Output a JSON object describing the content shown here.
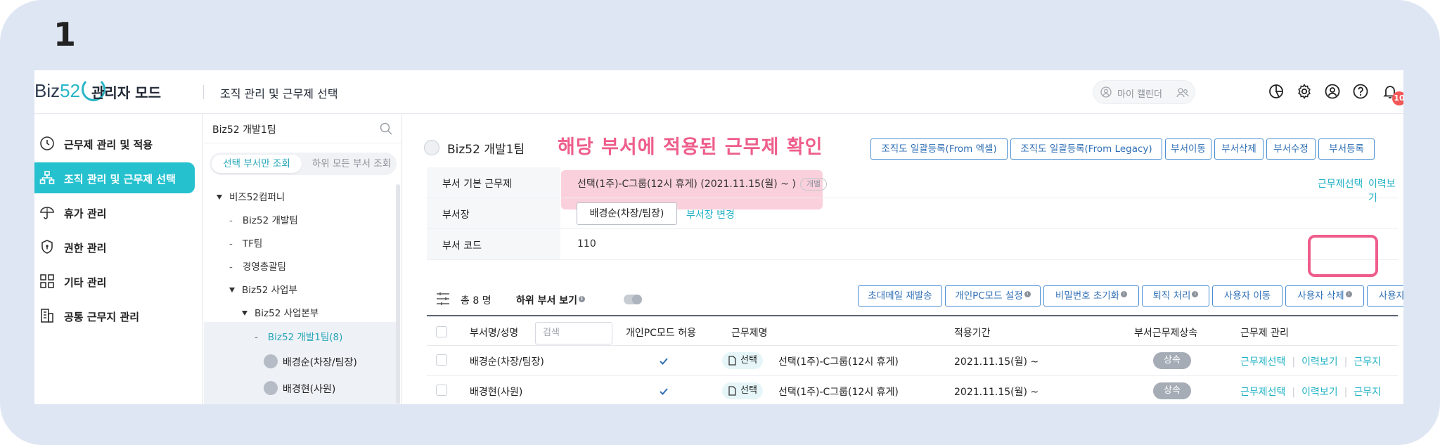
{
  "step_number": "1",
  "header": {
    "logo_text": "Biz",
    "logo_num": "52",
    "app_title": "관리자 모드",
    "page_title": "조직 관리 및 근무제 선택",
    "my_calendar": "마이 캘린더",
    "notification_count": "10"
  },
  "nav": {
    "items": [
      {
        "label": "근무제 관리 및 적용",
        "icon": "clock-icon"
      },
      {
        "label": "조직 관리 및 근무제 선택",
        "icon": "org-chart-icon"
      },
      {
        "label": "휴가 관리",
        "icon": "umbrella-icon"
      },
      {
        "label": "권한 관리",
        "icon": "shield-icon"
      },
      {
        "label": "기타 관리",
        "icon": "grid-icon"
      },
      {
        "label": "공통 근무지 관리",
        "icon": "building-icon"
      }
    ]
  },
  "tree": {
    "search_value": "Biz52 개발1팀",
    "seg_on": "선택 부서만 조회",
    "seg_off": "하위 모든 부서 조회",
    "nodes": [
      {
        "label": "비즈52컴퍼니"
      },
      {
        "label": "Biz52 개발팀"
      },
      {
        "label": "TF팀"
      },
      {
        "label": "경영총괄팀"
      },
      {
        "label": "Biz52 사업부"
      },
      {
        "label": "Biz52 사업본부"
      },
      {
        "label": "Biz52 개발1팀(8)"
      }
    ],
    "people": [
      "배경순(차장/팀장)",
      "배경현(사원)"
    ]
  },
  "main": {
    "team_title": "Biz52 개발1팀",
    "annotation": "해당 부서에 적용된 근무제 확인",
    "top_buttons": [
      "조직도 일괄등록(From 엑셀)",
      "조직도 일괄등록(From Legacy)",
      "부서이동",
      "부서삭제",
      "부서수정",
      "부서등록"
    ],
    "info": {
      "row1_key": "부서 기본 근무제",
      "row1_value": "선택(1주)-C그룹(12시 휴게) (2021.11.15(월) ~ )",
      "row1_pill": "개별",
      "row1_link1": "근무제선택",
      "row1_link2": "이력보기",
      "row2_key": "부서장",
      "row2_manager": "배경순(차장/팀장)",
      "row2_link": "부서장 변경",
      "row3_key": "부서 코드",
      "row3_value": "110"
    },
    "toolbar": {
      "count": "총 8 명",
      "sub_view": "하위 부서 보기",
      "buttons": [
        "초대메일 재발송",
        "개인PC모드 설정",
        "비밀번호 초기화",
        "퇴직 처리",
        "사용자 이동",
        "사용자 삭제",
        "사용자 등록"
      ]
    },
    "grid": {
      "headers": [
        "부서명/성명",
        "개인PC모드 허용",
        "근무제명",
        "적용기간",
        "부서근무제상속",
        "근무제 관리"
      ],
      "search_placeholder": "검색",
      "rows": [
        {
          "name": "배경순(차장/팀장)",
          "tag": "선택",
          "work": "선택(1주)-C그룹(12시 휴게)",
          "period": "2021.11.15(월) ~",
          "inherit": "상속",
          "a1": "근무제선택",
          "a2": "이력보기",
          "a3": "근무지"
        },
        {
          "name": "배경현(사원)",
          "tag": "선택",
          "work": "선택(1주)-C그룹(12시 휴게)",
          "period": "2021.11.15(월) ~",
          "inherit": "상속",
          "a1": "근무제선택",
          "a2": "이력보기",
          "a3": "근무지"
        }
      ]
    }
  },
  "colors": {
    "accent": "#25c1cf",
    "annotation": "#ee5d8b",
    "button_border": "#4a8fd4",
    "frame": "#dfe6f3"
  }
}
